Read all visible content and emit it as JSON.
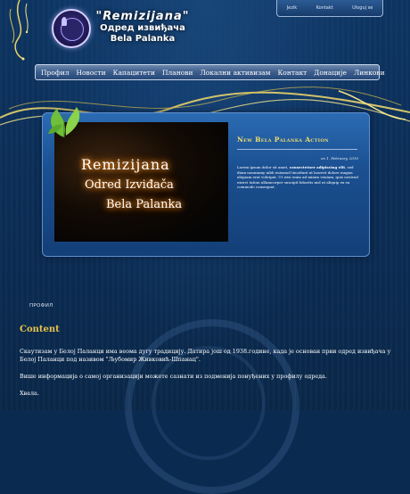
{
  "header": {
    "brand_line1": "\"Remizijana\"",
    "brand_line2": "Одред извиђача",
    "brand_line3": "Bela Palanka",
    "top_tabs": [
      "Jezik",
      "Kontakt",
      "Uloguj se"
    ]
  },
  "nav": {
    "items": [
      "Профил",
      "Новости",
      "Капацитети",
      "Планови",
      "Локални активизам",
      "Контакт",
      "Донације",
      "Линкови"
    ]
  },
  "featured": {
    "banner_line1": "Remizijana",
    "banner_line2": "Odred Izviđača",
    "banner_line3": "Bela Palanka",
    "news_title": "New Bela Palanka Action",
    "news_date": "on 1. February, 2010",
    "news_body_1": "Lorem ipsum dolor sit amet, ",
    "news_body_bold": "consectetuer adipiscing elit",
    "news_body_2": ", sed diam nonummy nibh euismod tincidunt ut laoreet dolore magna aliquam erat volutpat. Ut wisi enim ad minim veniam, quis nostrud exerci tation ullamcorper suscipit lobortis nisl ut aliquip ex ea commodo consequat."
  },
  "content": {
    "breadcrumb": "ПРОФИЛ",
    "title": "Content",
    "paragraph_1": "Скаутизам у Белој Паланци има веома дугу традицију. Датира још од 1938.године, када је основан први одред извиђача у Белој Паланци под називом \"Љубомир Живковић-Шпанац\".",
    "paragraph_2": "Више информација о самој организацији можете сазнати из подменија понуђених у профилу одреда.",
    "paragraph_3": "Хвала."
  },
  "icons": {
    "seal": "scout-seal-icon",
    "leaf": "green-leaf-icon",
    "swirl": "golden-swirl-icon"
  },
  "colors": {
    "background": "#0b2a4f",
    "accent_gold": "#e6c24a",
    "nav_bar": "#3b5d8c"
  }
}
